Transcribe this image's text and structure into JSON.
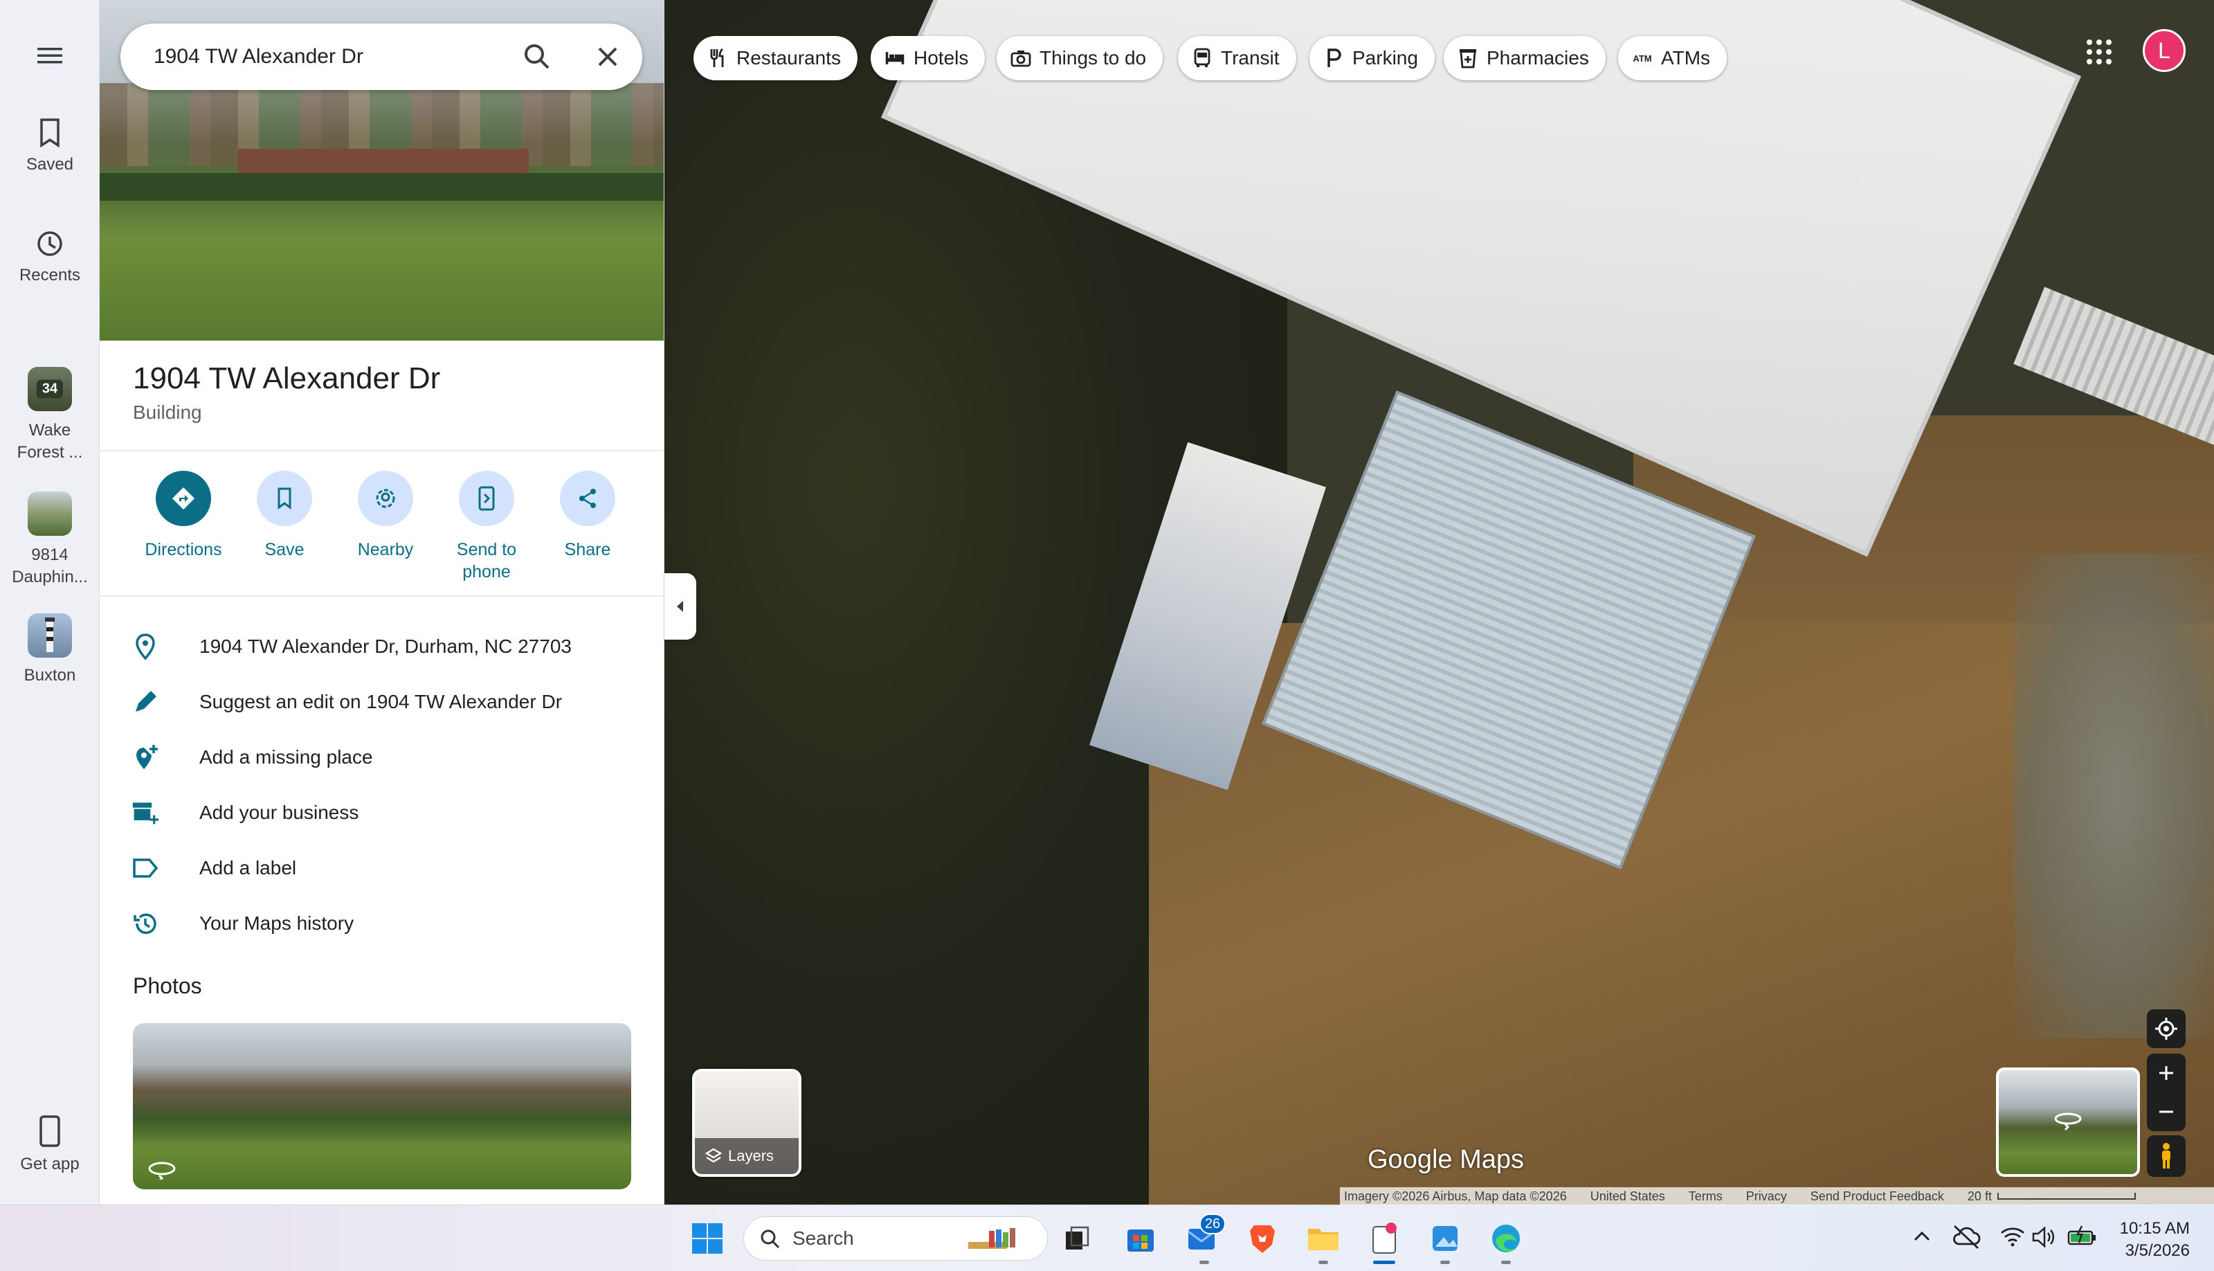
{
  "rail": {
    "saved": "Saved",
    "recents": "Recents",
    "recent_places": [
      {
        "badge": "34",
        "label": "Wake Forest ..."
      },
      {
        "badge": "",
        "label": "9814 Dauphin..."
      },
      {
        "badge": "",
        "label": "Buxton"
      }
    ],
    "get_app": "Get app"
  },
  "search": {
    "value": "1904 TW Alexander Dr"
  },
  "place": {
    "title": "1904 TW Alexander Dr",
    "type": "Building"
  },
  "actions": [
    {
      "label": "Directions",
      "icon": "directions-icon"
    },
    {
      "label": "Save",
      "icon": "bookmark-icon"
    },
    {
      "label": "Nearby",
      "icon": "nearby-icon"
    },
    {
      "label": "Send to phone",
      "icon": "send-to-phone-icon"
    },
    {
      "label": "Share",
      "icon": "share-icon"
    }
  ],
  "info": [
    {
      "text": "1904 TW Alexander Dr, Durham, NC 27703",
      "icon": "location-pin-icon"
    },
    {
      "text": "Suggest an edit on 1904 TW Alexander Dr",
      "icon": "pencil-icon"
    },
    {
      "text": "Add a missing place",
      "icon": "add-location-icon"
    },
    {
      "text": "Add your business",
      "icon": "add-business-icon"
    },
    {
      "text": "Add a label",
      "icon": "label-icon"
    },
    {
      "text": "Your Maps history",
      "icon": "history-icon"
    }
  ],
  "photos": {
    "heading": "Photos"
  },
  "chips": [
    {
      "label": "Restaurants",
      "icon": "fork-knife-icon"
    },
    {
      "label": "Hotels",
      "icon": "bed-icon"
    },
    {
      "label": "Things to do",
      "icon": "camera-icon"
    },
    {
      "label": "Transit",
      "icon": "bus-icon"
    },
    {
      "label": "Parking",
      "icon": "parking-icon"
    },
    {
      "label": "Pharmacies",
      "icon": "pharmacy-icon"
    },
    {
      "label": "ATMs",
      "icon": "atm-icon"
    }
  ],
  "account": {
    "initial": "L"
  },
  "map": {
    "layers_label": "Layers",
    "brand": "Google Maps",
    "attribution": [
      "Imagery ©2026 Airbus, Map data ©2026",
      "United States",
      "Terms",
      "Privacy",
      "Send Product Feedback"
    ],
    "scale": "20 ft"
  },
  "taskbar": {
    "search_placeholder": "Search",
    "mail_badge": "26",
    "time": "10:15 AM",
    "date": "3/5/2026"
  },
  "colors": {
    "accent": "#0b6e86",
    "chip_bg": "#d3e3fd",
    "avatar": "#e8336a"
  }
}
